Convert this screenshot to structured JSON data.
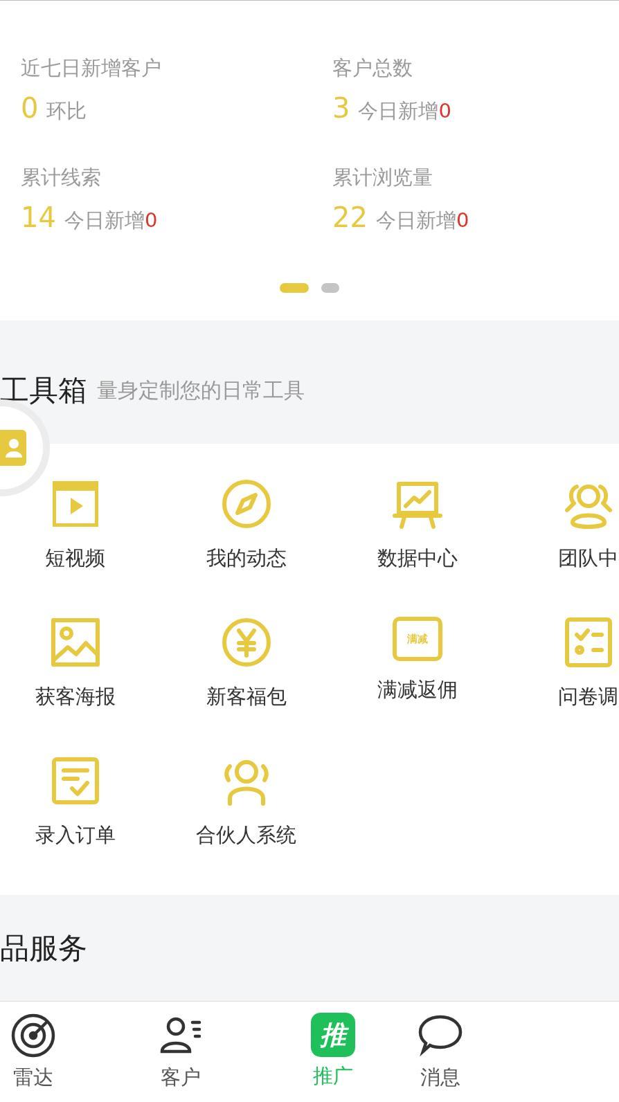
{
  "stats": [
    {
      "label": "近七日新增客户",
      "value": "0",
      "note": "环比"
    },
    {
      "label": "客户总数",
      "value": "3",
      "note": "今日新增",
      "delta": "0"
    },
    {
      "label": "累计线索",
      "value": "14",
      "note": "今日新增",
      "delta": "0"
    },
    {
      "label": "累计浏览量",
      "value": "22",
      "note": "今日新增",
      "delta": "0"
    }
  ],
  "pager": [
    {
      "selected": true
    },
    {
      "selected": false
    }
  ],
  "toolbox": {
    "title": "工具箱",
    "subtitle": "量身定制您的日常工具",
    "tools": [
      {
        "kind": "video",
        "label": "短视频"
      },
      {
        "kind": "compass",
        "label": "我的动态"
      },
      {
        "kind": "chart",
        "label": "数据中心"
      },
      {
        "kind": "team",
        "label": "团队中"
      },
      {
        "kind": "image",
        "label": "获客海报"
      },
      {
        "kind": "yen",
        "label": "新客福包"
      },
      {
        "kind": "coupon",
        "label": "满减返佣",
        "icon_text": "满减"
      },
      {
        "kind": "survey",
        "label": "问卷调"
      },
      {
        "kind": "order",
        "label": "录入订单"
      },
      {
        "kind": "partner",
        "label": "合伙人系统"
      }
    ]
  },
  "goods": {
    "title": "品服务"
  },
  "tab_bar": [
    {
      "kind": "radar",
      "label": "雷达",
      "selected": false
    },
    {
      "kind": "customer",
      "label": "客户",
      "selected": false
    },
    {
      "kind": "promote",
      "label": "推广",
      "selected": true,
      "icon_text": "推"
    },
    {
      "kind": "message",
      "label": "消息",
      "selected": false
    }
  ]
}
